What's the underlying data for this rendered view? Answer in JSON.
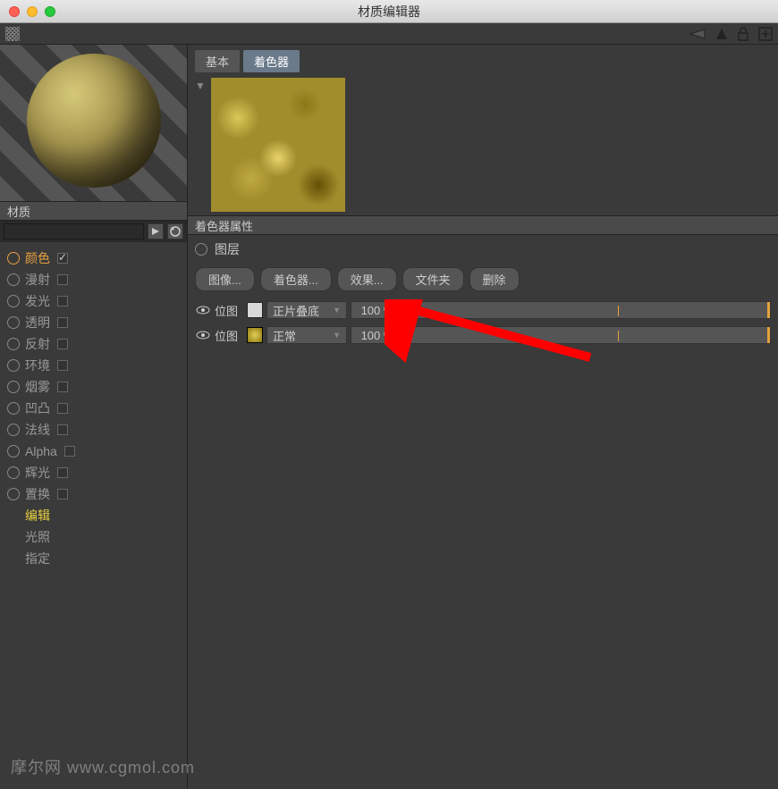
{
  "window": {
    "title": "材质编辑器"
  },
  "sidebar": {
    "header": "材质",
    "channels": [
      {
        "label": "颜色",
        "active": true,
        "checked": true,
        "hasRadio": true
      },
      {
        "label": "漫射",
        "active": false,
        "checked": false,
        "hasRadio": true
      },
      {
        "label": "发光",
        "active": false,
        "checked": false,
        "hasRadio": true
      },
      {
        "label": "透明",
        "active": false,
        "checked": false,
        "hasRadio": true
      },
      {
        "label": "反射",
        "active": false,
        "checked": false,
        "hasRadio": true
      },
      {
        "label": "环境",
        "active": false,
        "checked": false,
        "hasRadio": true
      },
      {
        "label": "烟雾",
        "active": false,
        "checked": false,
        "hasRadio": true
      },
      {
        "label": "凹凸",
        "active": false,
        "checked": false,
        "hasRadio": true
      },
      {
        "label": "法线",
        "active": false,
        "checked": false,
        "hasRadio": true
      },
      {
        "label": "Alpha",
        "active": false,
        "checked": false,
        "hasRadio": true
      },
      {
        "label": "辉光",
        "active": false,
        "checked": false,
        "hasRadio": true
      },
      {
        "label": "置换",
        "active": false,
        "checked": false,
        "hasRadio": true
      },
      {
        "label": "编辑",
        "active": false,
        "checked": false,
        "hasRadio": false,
        "yellow": true
      },
      {
        "label": "光照",
        "active": false,
        "checked": false,
        "hasRadio": false
      },
      {
        "label": "指定",
        "active": false,
        "checked": false,
        "hasRadio": false
      }
    ]
  },
  "tabs": [
    {
      "label": "基本",
      "active": false
    },
    {
      "label": "着色器",
      "active": true
    }
  ],
  "shader": {
    "props_header": "着色器属性",
    "layer_label": "图层",
    "buttons": [
      "图像...",
      "着色器...",
      "效果...",
      "文件夹",
      "删除"
    ],
    "layers": [
      {
        "name": "位图",
        "blend": "正片叠底",
        "opacity": "100 %",
        "swatch": "light"
      },
      {
        "name": "位图",
        "blend": "正常",
        "opacity": "100 %",
        "swatch": "tex"
      }
    ]
  },
  "watermark": "摩尔网 www.cgmol.com"
}
